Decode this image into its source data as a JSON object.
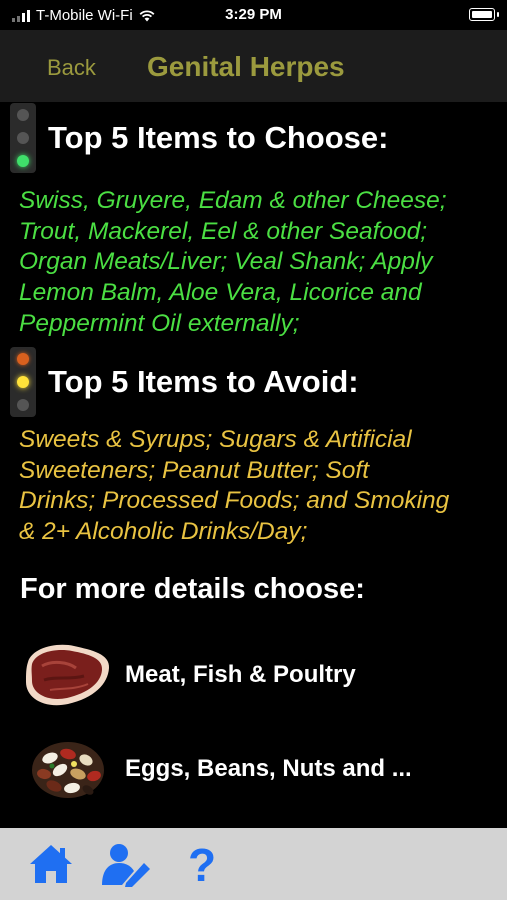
{
  "status_bar": {
    "carrier": "T-Mobile Wi-Fi",
    "time": "3:29 PM"
  },
  "nav": {
    "back_label": "Back",
    "title": "Genital Herpes",
    "title_color": "#9b9a3e"
  },
  "choose_section": {
    "title": "Top 5 Items to Choose:",
    "lines": [
      "Swiss, Gruyere, Edam & other Cheese;",
      "Trout, Mackerel, Eel & other Seafood;",
      "Organ Meats/Liver; Veal Shank; Apply",
      "Lemon Balm, Aloe Vera, Licorice and",
      "Peppermint Oil externally;"
    ],
    "text_color": "#4bdf43"
  },
  "avoid_section": {
    "title": "Top 5 Items to Avoid:",
    "lines": [
      "Sweets & Syrups; Sugars & Artificial",
      "Sweeteners; Peanut Butter; Soft",
      "Drinks; Processed Foods; and Smoking",
      "& 2+ Alcoholic Drinks/Day;"
    ],
    "text_color": "#e9c342"
  },
  "details": {
    "heading": "For more details choose:",
    "categories": [
      {
        "label": "Meat, Fish & Poultry",
        "icon": "steak-icon"
      },
      {
        "label": "Eggs, Beans, Nuts and ...",
        "icon": "beans-icon"
      }
    ]
  },
  "tab_bar": {
    "items": [
      {
        "icon": "home-icon"
      },
      {
        "icon": "edit-profile-icon"
      },
      {
        "icon": "help-icon"
      }
    ],
    "icon_color": "#1f6ff2"
  }
}
